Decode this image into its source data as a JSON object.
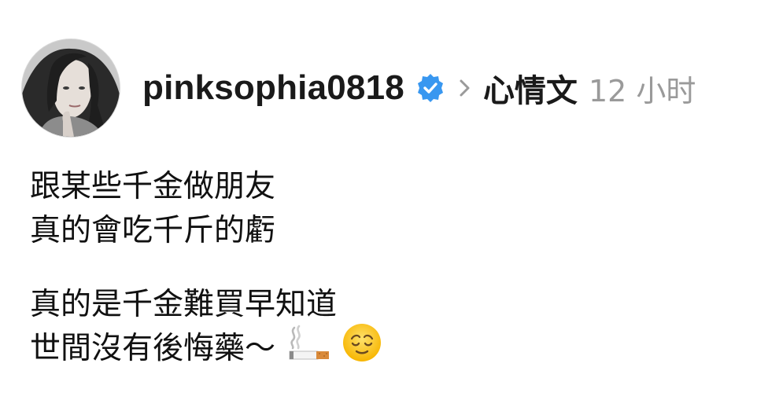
{
  "post": {
    "username": "pinksophia0818",
    "topic": "心情文",
    "time": "12 小时",
    "lines": [
      "跟某些千金做朋友",
      "真的會吃千斤的虧",
      "真的是千金難買早知道",
      "世間沒有後悔藥～"
    ],
    "emojis": [
      "cigarette-emoji",
      "relieved-face-emoji"
    ]
  },
  "colors": {
    "verified_badge": "#3897f0",
    "time_text": "#9a9a9a",
    "chevron": "#9a9a9a"
  },
  "icons": {
    "verified": "verified-badge-icon",
    "chevron": "chevron-right-icon"
  }
}
